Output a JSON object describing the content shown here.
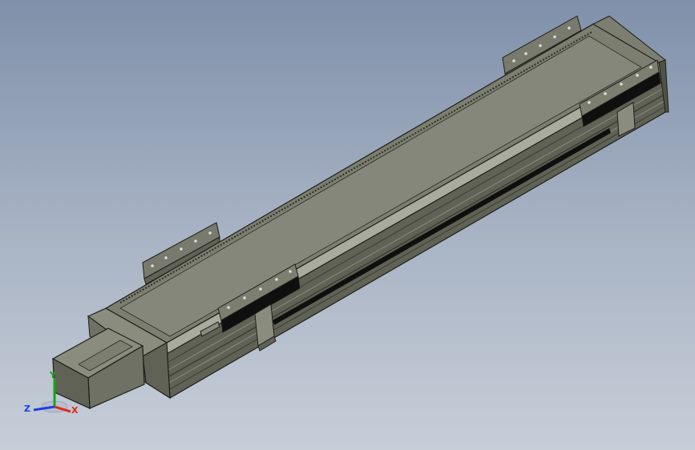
{
  "viewport": {
    "background_top": "#7f90aa",
    "background_bottom": "#c7ced8"
  },
  "model": {
    "colors": {
      "top_face": "#7c7f70",
      "top_face_light": "#8a8d7e",
      "side_face": "#5f6254",
      "edge": "#1e1e1a",
      "dark_slot": "#0f0f0f",
      "rail_light": "#a9ab9e"
    }
  },
  "triad": {
    "x_label": "X",
    "y_label": "Y",
    "z_label": "Z",
    "x_color": "#e0261b",
    "y_color": "#1aa31a",
    "z_color": "#1f3ee0"
  }
}
